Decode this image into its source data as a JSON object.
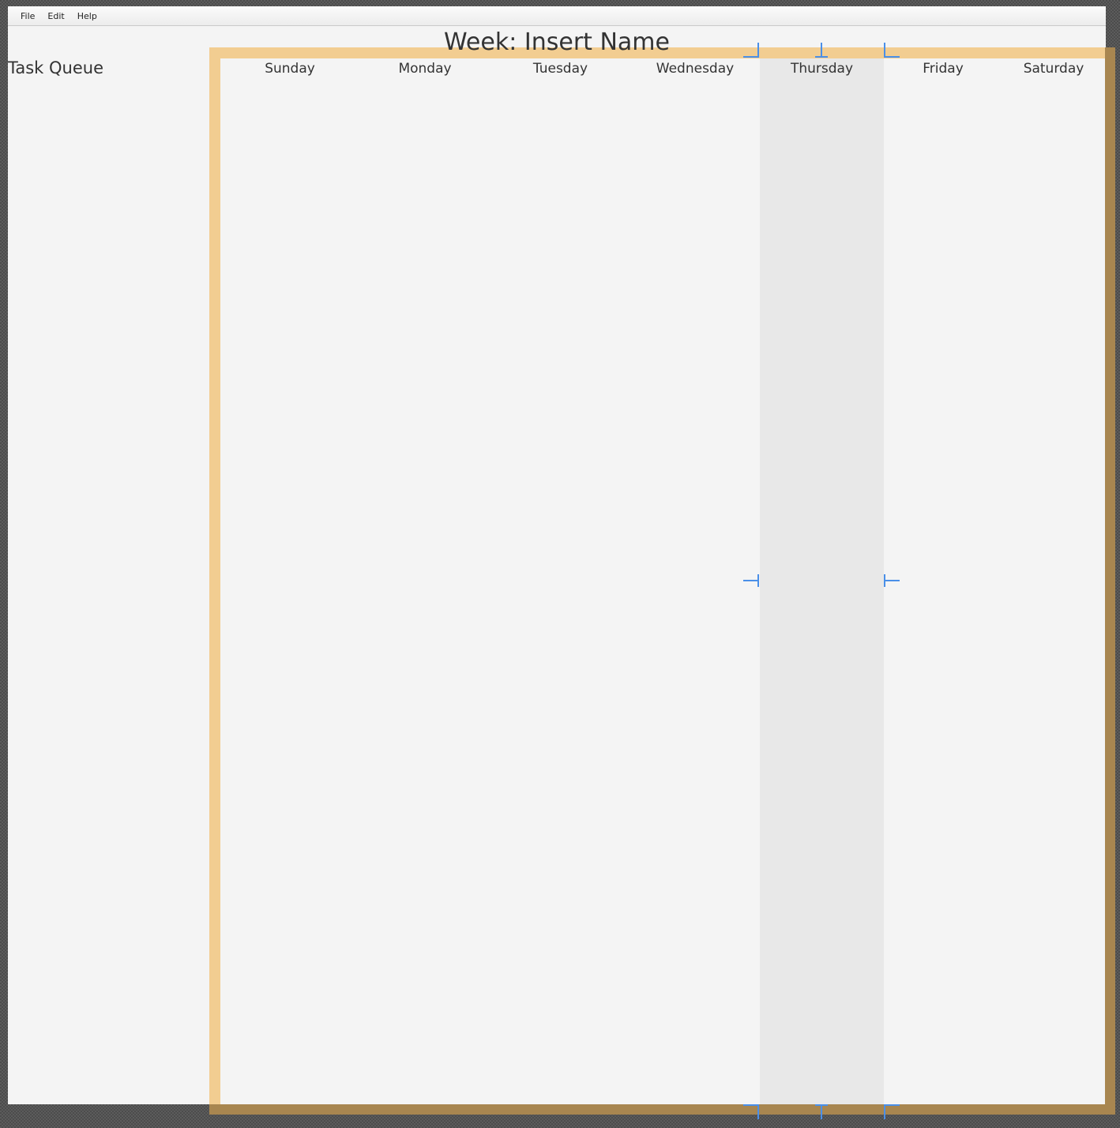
{
  "menubar": {
    "items": [
      "File",
      "Edit",
      "Help"
    ]
  },
  "sidebar": {
    "title": "Task Queue"
  },
  "week": {
    "title": "Week: Insert Name"
  },
  "calendar": {
    "days": [
      "Sunday",
      "Monday",
      "Tuesday",
      "Wednesday",
      "Thursday",
      "Friday",
      "Saturday"
    ],
    "selected_day": "Thursday"
  },
  "colors": {
    "selection_border": "#f2cd91",
    "selection_shadow": "#a88650",
    "selected_column": "#e8e8e8",
    "resize_handle": "#4a8fe8"
  }
}
